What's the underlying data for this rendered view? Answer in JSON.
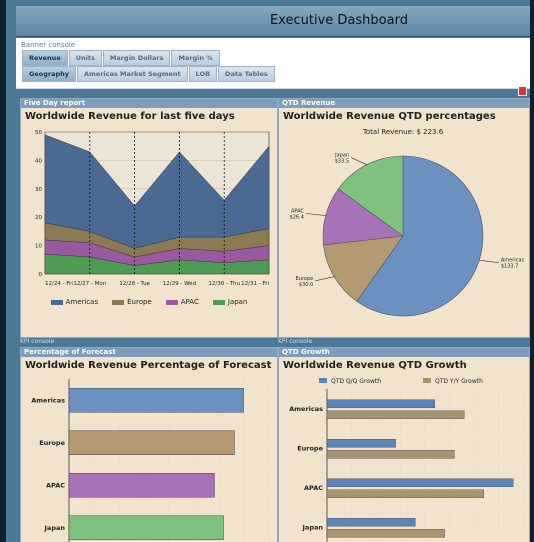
{
  "header": {
    "title": "Executive Dashboard",
    "brand_lines": [
      "",
      ""
    ]
  },
  "banner": {
    "label": "Banner console"
  },
  "tabs_row1": [
    "Revenue",
    "Units",
    "Margin Dollars",
    "Margin %"
  ],
  "tabs_row2": [
    "Geography",
    "Americas Market Segment",
    "LOB",
    "Data Tables"
  ],
  "kpi_label": "KPI console",
  "panels": {
    "five_day": {
      "header": "Five Day report",
      "title": "Worldwide Revenue for last five days"
    },
    "qtd_rev": {
      "header": "QTD Revenue",
      "title": "Worldwide Revenue QTD percentages"
    },
    "pct_forecast": {
      "header": "Percentage of Forecast",
      "title": "Worldwide Revenue Percentage of Forecast"
    },
    "qtd_growth": {
      "header": "QTD Growth",
      "title": "Worldwide Revenue QTD Growth"
    }
  },
  "chart_data": [
    {
      "type": "area",
      "title": "Worldwide Revenue for last five days",
      "categories": [
        "12/24 - Fri",
        "12/27 - Mon",
        "12/28 - Tue",
        "12/29 - Wed",
        "12/30 - Thu",
        "12/31 - Fri"
      ],
      "ylim": [
        0,
        50
      ],
      "yticks": [
        0,
        10,
        20,
        30,
        40,
        50
      ],
      "series": [
        {
          "name": "Japan",
          "values": [
            7,
            6,
            3,
            5,
            4,
            5
          ]
        },
        {
          "name": "APAC",
          "values": [
            5,
            5,
            3,
            4,
            4,
            5
          ]
        },
        {
          "name": "Europe",
          "values": [
            6,
            4,
            3,
            4,
            5,
            6
          ]
        },
        {
          "name": "Americas",
          "values": [
            31,
            28,
            15,
            30,
            13,
            29
          ]
        }
      ],
      "legend": [
        "Americas",
        "Europe",
        "APAC",
        "Japan"
      ],
      "colors": {
        "Americas": "#4a6a94",
        "Europe": "#8c7a55",
        "APAC": "#9a5aa0",
        "Japan": "#4f9a55"
      }
    },
    {
      "type": "pie",
      "title": "Worldwide Revenue QTD percentages",
      "total_label": "Total Revenue: $ 223.6",
      "slices": [
        {
          "name": "Americas",
          "value": 133.7,
          "label": "Americas\n$133.7",
          "color": "#6a91c0"
        },
        {
          "name": "Europe",
          "value": 30.0,
          "label": "Europe\n$30.0",
          "color": "#b49a70"
        },
        {
          "name": "APAC",
          "value": 26.4,
          "label": "APAC\n$26.4",
          "color": "#a872b8"
        },
        {
          "name": "Japan",
          "value": 33.5,
          "label": "Japan\n$33.5",
          "color": "#7fc27f"
        }
      ]
    },
    {
      "type": "bar",
      "title": "Worldwide Revenue Percentage of Forecast",
      "categories": [
        "Americas",
        "Europe",
        "APAC",
        "Japan"
      ],
      "values": [
        96,
        91,
        80,
        85
      ],
      "xlim": [
        0,
        110
      ],
      "colors": [
        "#6a91c0",
        "#b49a70",
        "#a872b8",
        "#7fc27f"
      ]
    },
    {
      "type": "bar",
      "title": "Worldwide Revenue QTD Growth",
      "categories": [
        "Americas",
        "Europe",
        "APAC",
        "Japan"
      ],
      "series": [
        {
          "name": "QTD Q/Q Growth",
          "values": [
            11,
            7,
            19,
            9
          ],
          "color": "#5a84ba"
        },
        {
          "name": "QTD Y/Y Growth",
          "values": [
            14,
            13,
            16,
            12
          ],
          "color": "#a99472"
        }
      ],
      "xlim": [
        0,
        20
      ]
    }
  ]
}
